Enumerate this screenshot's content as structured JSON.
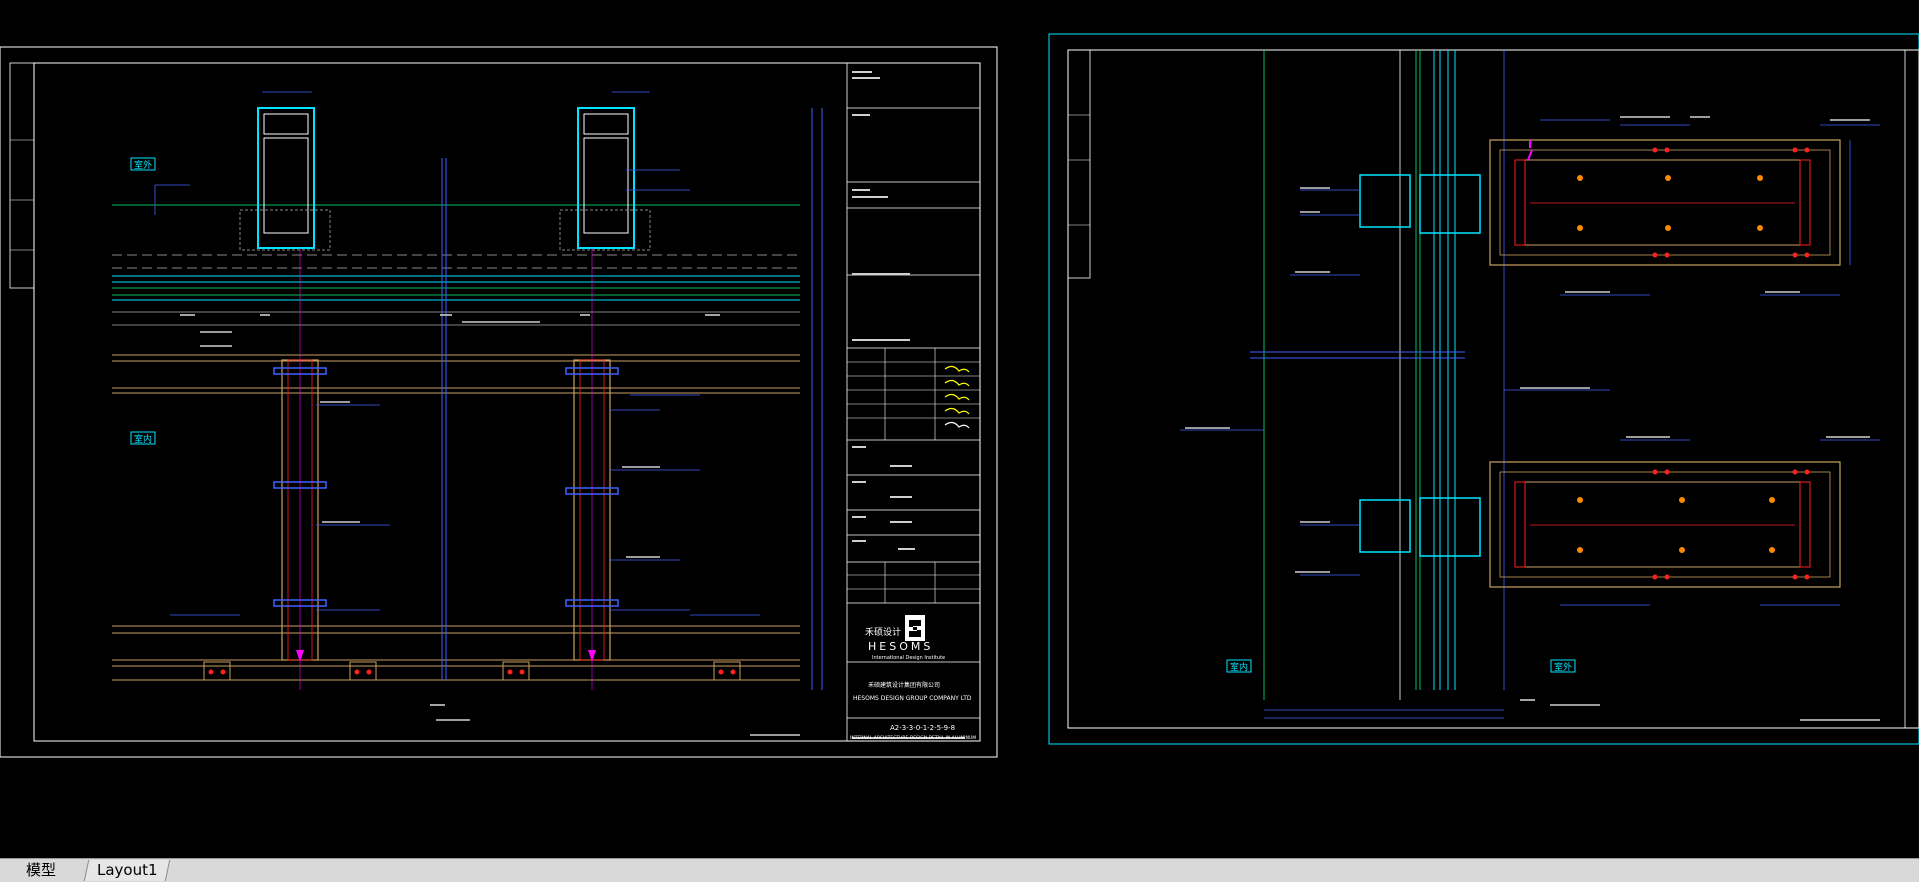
{
  "tabs": {
    "model": "模型",
    "layout": "Layout1"
  },
  "sheet_left": {
    "tag_top": "室外",
    "tag_mid": "室内",
    "logo_name": "HESOMS",
    "logo_sub": "International Design Institute",
    "company_cn": "禾硕建筑设计集团有限公司",
    "company_en": "HESOMS DESIGN GROUP COMPANY LTD",
    "drawing_no": "A2-3-3-0-1-2-5-9-8",
    "footer": "INTERNAL ARCHITECTURE DESIGN DETAIL IN ALUMINUM"
  },
  "sheet_right": {
    "tag_left": "室内",
    "tag_right": "室外"
  },
  "colors": {
    "background": "#000000",
    "frame": "#ffffff",
    "border_cyan": "#00e5ff",
    "green": "#00c060",
    "red": "#ff2020",
    "yellow": "#ffff00",
    "magenta": "#ff00ff",
    "orange": "#ff8800",
    "blue": "#4060ff",
    "tan": "#c8a060"
  }
}
